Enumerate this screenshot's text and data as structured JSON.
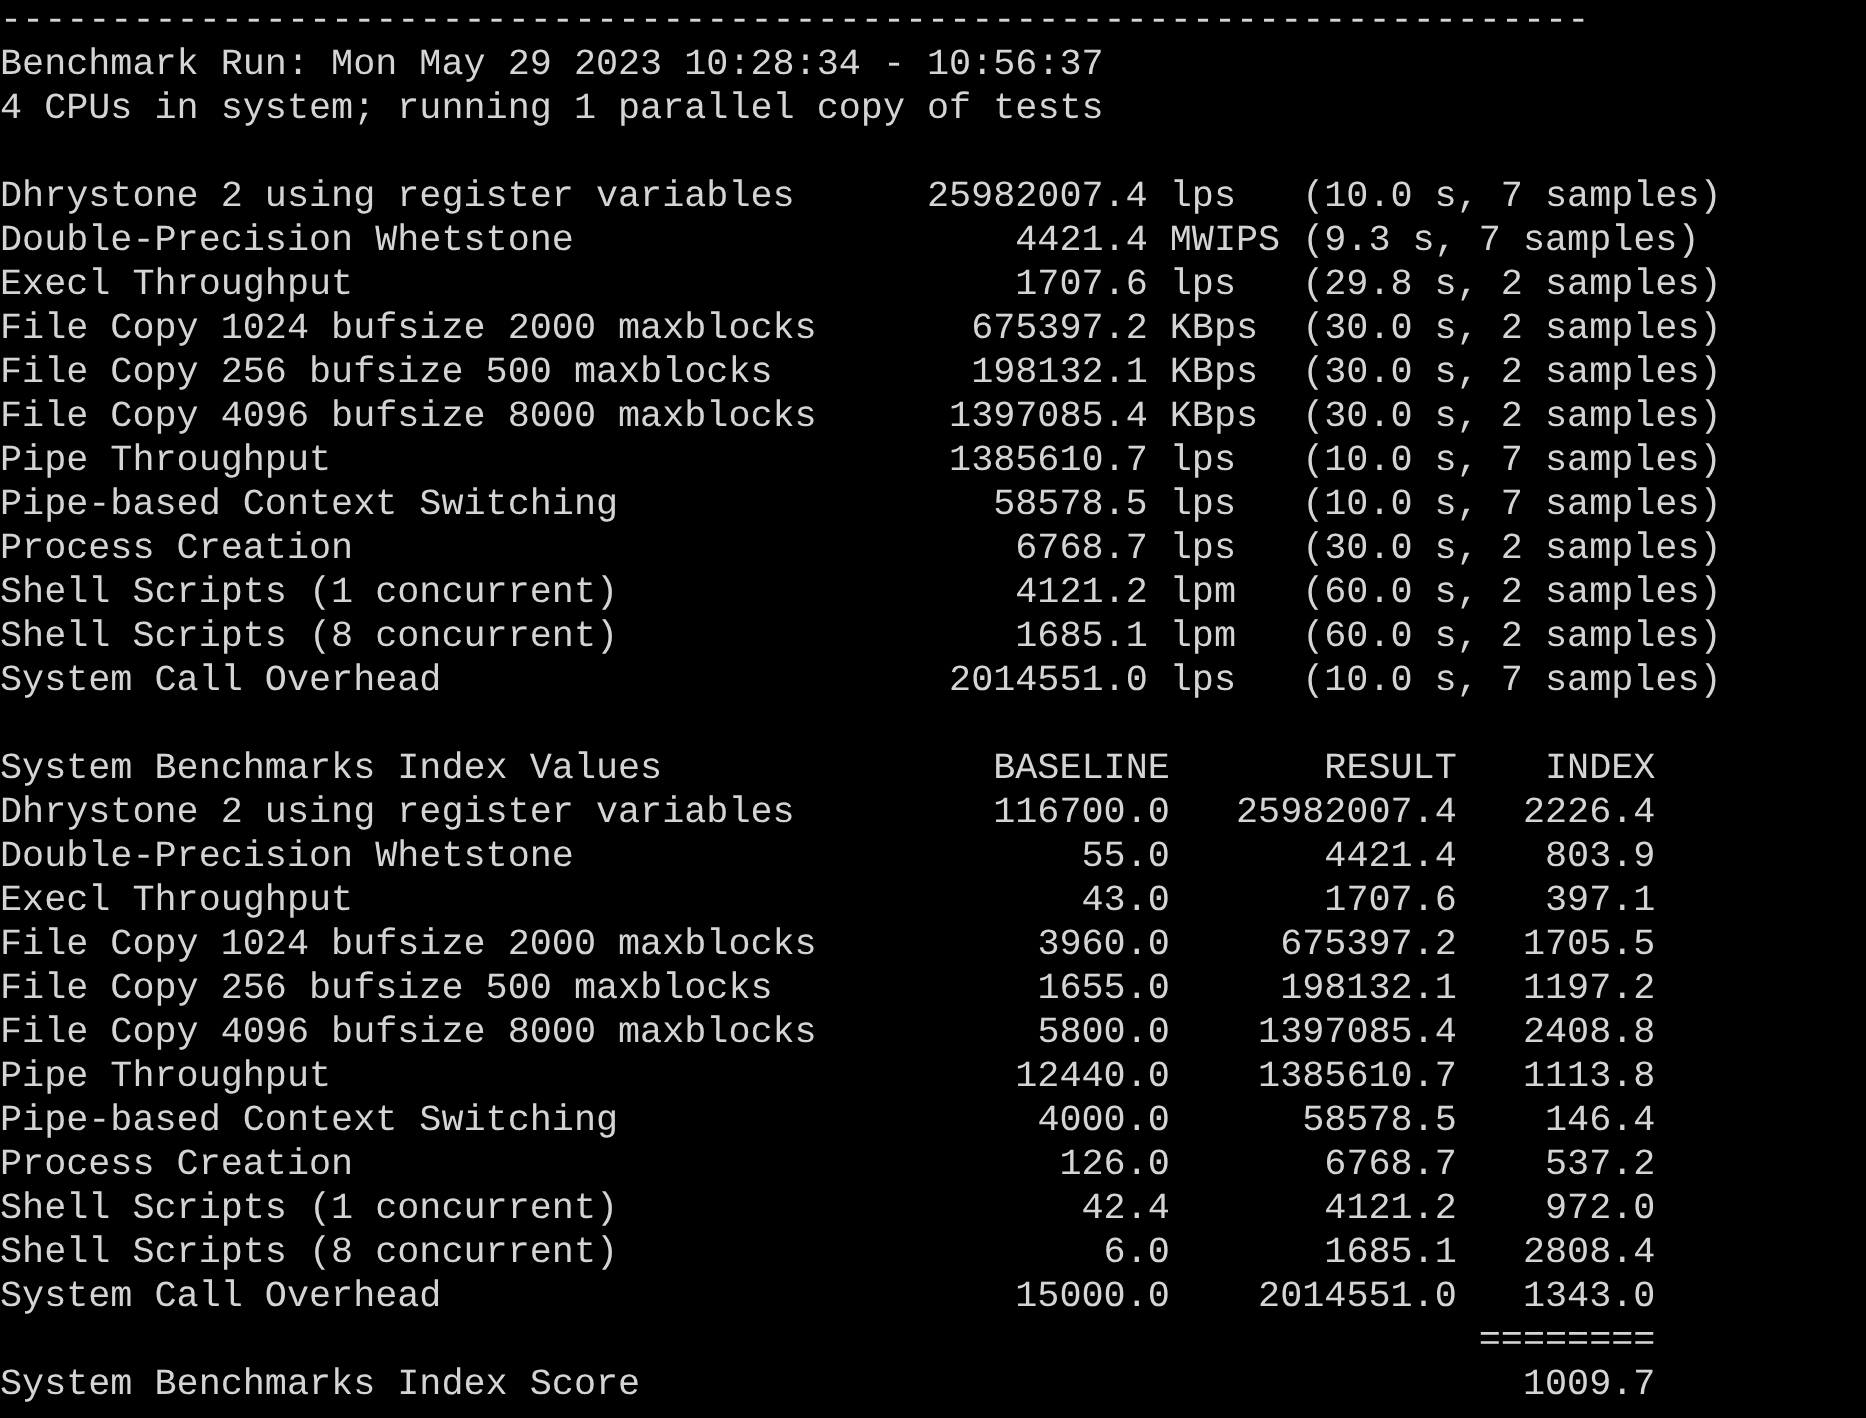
{
  "separator": "------------------------------------------------------------------------",
  "header": [
    "Benchmark Run: Mon May 29 2023 10:28:34 - 10:56:37",
    "4 CPUs in system; running 1 parallel copy of tests"
  ],
  "results": [
    {
      "name": "Dhrystone 2 using register variables",
      "value": "25982007.4",
      "unit": "lps",
      "detail": "(10.0 s, 7 samples)"
    },
    {
      "name": "Double-Precision Whetstone",
      "value": "4421.4",
      "unit": "MWIPS",
      "detail": "(9.3 s, 7 samples)"
    },
    {
      "name": "Execl Throughput",
      "value": "1707.6",
      "unit": "lps",
      "detail": "(29.8 s, 2 samples)"
    },
    {
      "name": "File Copy 1024 bufsize 2000 maxblocks",
      "value": "675397.2",
      "unit": "KBps",
      "detail": "(30.0 s, 2 samples)"
    },
    {
      "name": "File Copy 256 bufsize 500 maxblocks",
      "value": "198132.1",
      "unit": "KBps",
      "detail": "(30.0 s, 2 samples)"
    },
    {
      "name": "File Copy 4096 bufsize 8000 maxblocks",
      "value": "1397085.4",
      "unit": "KBps",
      "detail": "(30.0 s, 2 samples)"
    },
    {
      "name": "Pipe Throughput",
      "value": "1385610.7",
      "unit": "lps",
      "detail": "(10.0 s, 7 samples)"
    },
    {
      "name": "Pipe-based Context Switching",
      "value": "58578.5",
      "unit": "lps",
      "detail": "(10.0 s, 7 samples)"
    },
    {
      "name": "Process Creation",
      "value": "6768.7",
      "unit": "lps",
      "detail": "(30.0 s, 2 samples)"
    },
    {
      "name": "Shell Scripts (1 concurrent)",
      "value": "4121.2",
      "unit": "lpm",
      "detail": "(60.0 s, 2 samples)"
    },
    {
      "name": "Shell Scripts (8 concurrent)",
      "value": "1685.1",
      "unit": "lpm",
      "detail": "(60.0 s, 2 samples)"
    },
    {
      "name": "System Call Overhead",
      "value": "2014551.0",
      "unit": "lps",
      "detail": "(10.0 s, 7 samples)"
    }
  ],
  "index_table": {
    "title": "System Benchmarks Index Values",
    "columns": [
      "BASELINE",
      "RESULT",
      "INDEX"
    ],
    "rows": [
      {
        "name": "Dhrystone 2 using register variables",
        "baseline": "116700.0",
        "result": "25982007.4",
        "index": "2226.4"
      },
      {
        "name": "Double-Precision Whetstone",
        "baseline": "55.0",
        "result": "4421.4",
        "index": "803.9"
      },
      {
        "name": "Execl Throughput",
        "baseline": "43.0",
        "result": "1707.6",
        "index": "397.1"
      },
      {
        "name": "File Copy 1024 bufsize 2000 maxblocks",
        "baseline": "3960.0",
        "result": "675397.2",
        "index": "1705.5"
      },
      {
        "name": "File Copy 256 bufsize 500 maxblocks",
        "baseline": "1655.0",
        "result": "198132.1",
        "index": "1197.2"
      },
      {
        "name": "File Copy 4096 bufsize 8000 maxblocks",
        "baseline": "5800.0",
        "result": "1397085.4",
        "index": "2408.8"
      },
      {
        "name": "Pipe Throughput",
        "baseline": "12440.0",
        "result": "1385610.7",
        "index": "1113.8"
      },
      {
        "name": "Pipe-based Context Switching",
        "baseline": "4000.0",
        "result": "58578.5",
        "index": "146.4"
      },
      {
        "name": "Process Creation",
        "baseline": "126.0",
        "result": "6768.7",
        "index": "537.2"
      },
      {
        "name": "Shell Scripts (1 concurrent)",
        "baseline": "42.4",
        "result": "4121.2",
        "index": "972.0"
      },
      {
        "name": "Shell Scripts (8 concurrent)",
        "baseline": "6.0",
        "result": "1685.1",
        "index": "2808.4"
      },
      {
        "name": "System Call Overhead",
        "baseline": "15000.0",
        "result": "2014551.0",
        "index": "1343.0"
      }
    ],
    "total_rule": "========",
    "score_label": "System Benchmarks Index Score",
    "score": "1009.7"
  }
}
